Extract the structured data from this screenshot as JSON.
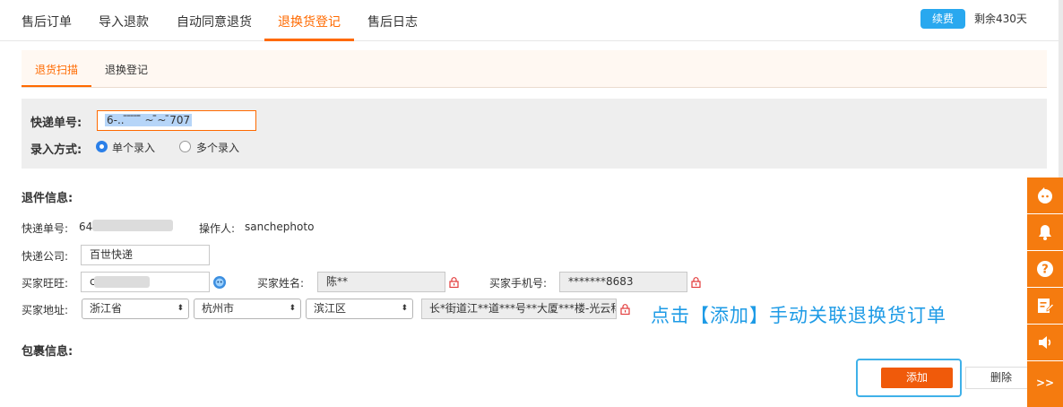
{
  "top_tabs": [
    {
      "label": "售后订单",
      "active": false
    },
    {
      "label": "导入退款",
      "active": false
    },
    {
      "label": "自动同意退货",
      "active": false
    },
    {
      "label": "退换货登记",
      "active": true
    },
    {
      "label": "售后日志",
      "active": false
    }
  ],
  "subscription": {
    "renew_label": "续费",
    "remaining": "剩余430天"
  },
  "sub_tabs": [
    {
      "label": "退货扫描",
      "active": true
    },
    {
      "label": "退换登记",
      "active": false
    }
  ],
  "scan": {
    "tracking_label": "快递单号:",
    "tracking_value": "6-.. ̄ ̄ ̄  ̄ ̄̄ ~ ̄̄~ ̄707",
    "mode_label": "录入方式:",
    "modes": [
      {
        "label": "单个录入",
        "selected": true
      },
      {
        "label": "多个录入",
        "selected": false
      }
    ]
  },
  "return_info": {
    "title": "退件信息:",
    "tracking_label": "快递单号:",
    "tracking_value": "64",
    "operator_label": "操作人:",
    "operator_value": "sanchephoto",
    "courier_label": "快递公司:",
    "courier_value": "百世快递",
    "wangwang_label": "买家旺旺:",
    "wangwang_value": "c",
    "buyer_name_label": "买家姓名:",
    "buyer_name_value": "陈**",
    "buyer_phone_label": "买家手机号:",
    "buyer_phone_value": "*******8683",
    "address_label": "买家地址:",
    "province": "浙江省",
    "city": "杭州市",
    "district": "滨江区",
    "street": "长*街道江**道***号**大厦***楼-光云科"
  },
  "callout": "点击【添加】手动关联退换货订单",
  "package_info": {
    "title": "包裹信息:"
  },
  "actions": {
    "add_label": "添加",
    "delete_label": "删除"
  },
  "toolbar": {
    "expand_label": ">>"
  },
  "colors": {
    "accent": "#ff6a00",
    "blue": "#29a8ef",
    "toolbar": "#f57b0f"
  }
}
